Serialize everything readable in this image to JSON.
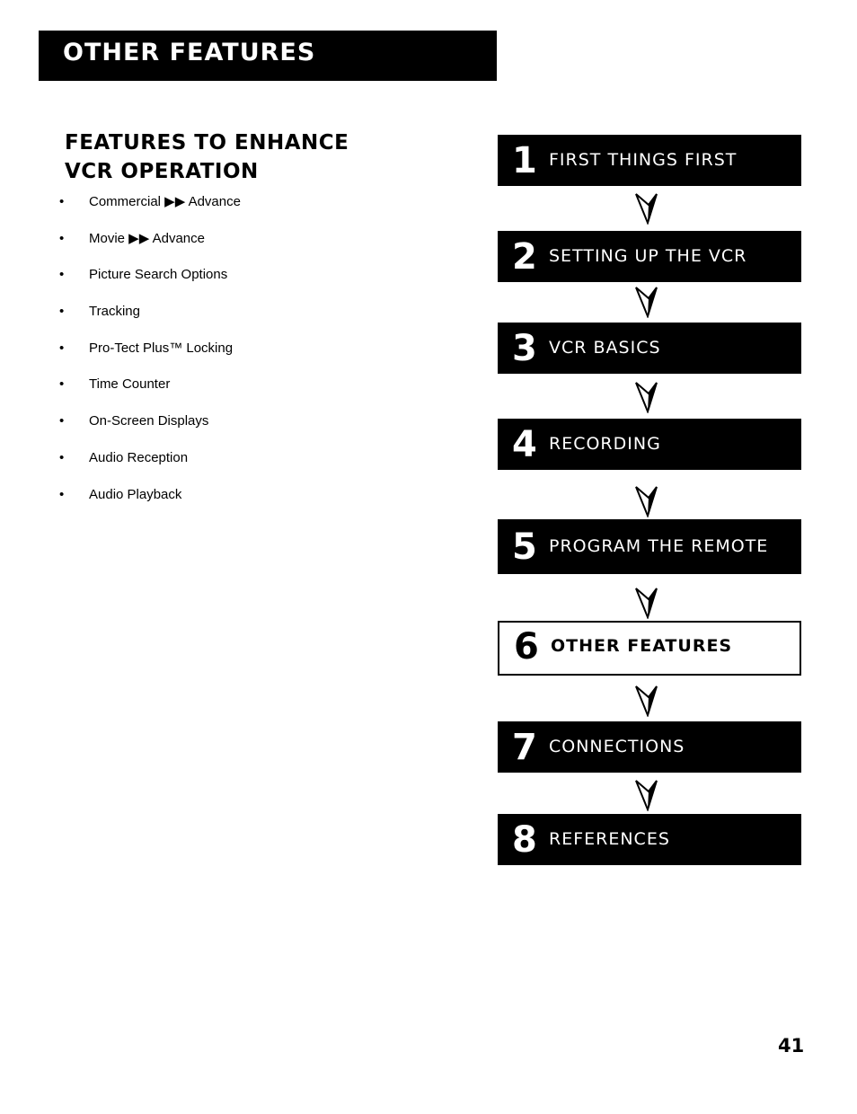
{
  "header": {
    "title": "OTHER FEATURES"
  },
  "section": {
    "heading_line1": "FEATURES TO ENHANCE",
    "heading_line2": "VCR OPERATION",
    "bullet_glyph": "•",
    "items": [
      "Commercial ▶▶ Advance",
      "Movie ▶▶ Advance",
      "Picture Search Options",
      "Tracking",
      "Pro-Tect Plus™ Locking",
      "Time Counter",
      "On-Screen Displays",
      "Audio Reception",
      "Audio Playback"
    ]
  },
  "steps": [
    {
      "number": "1",
      "label": "FIRST THINGS FIRST",
      "current": false
    },
    {
      "number": "2",
      "label": "SETTING UP THE VCR",
      "current": false
    },
    {
      "number": "3",
      "label": "VCR BASICS",
      "current": false
    },
    {
      "number": "4",
      "label": "RECORDING",
      "current": false
    },
    {
      "number": "5",
      "label": "PROGRAM THE REMOTE",
      "current": false
    },
    {
      "number": "6",
      "label": "OTHER FEATURES",
      "current": true
    },
    {
      "number": "7",
      "label": "CONNECTIONS",
      "current": false
    },
    {
      "number": "8",
      "label": "REFERENCES",
      "current": false
    }
  ],
  "connector_icon": "down-arrowhead-icon",
  "page_number": "41"
}
